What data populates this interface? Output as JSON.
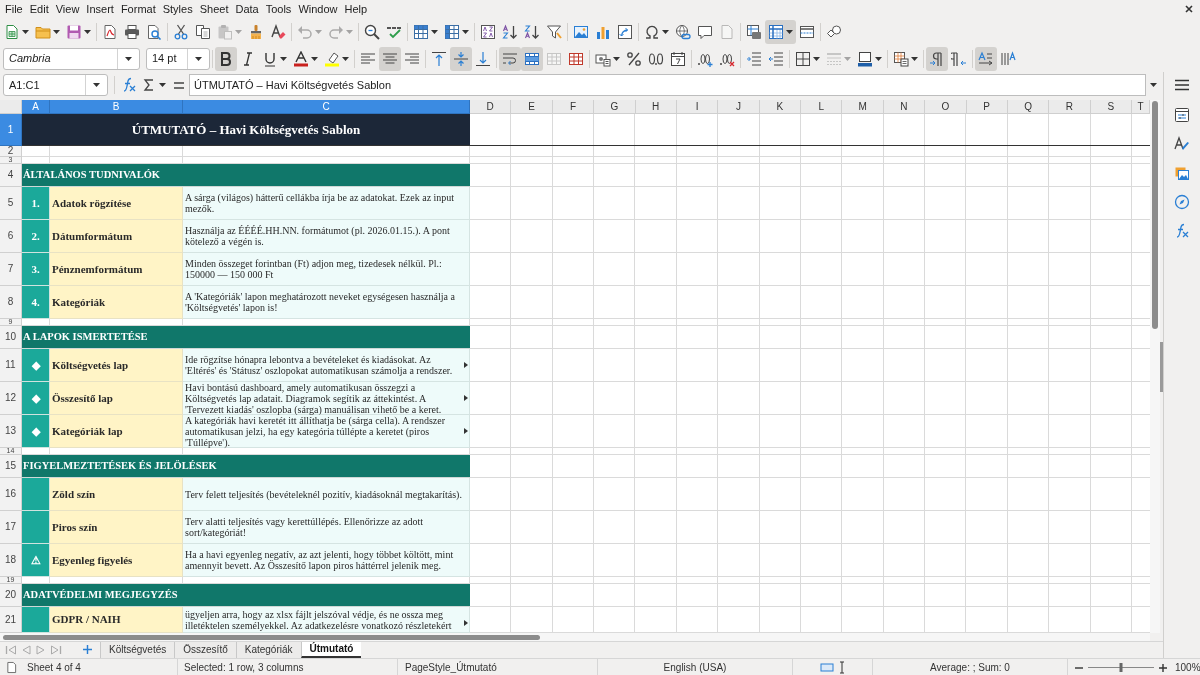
{
  "menu_bar": {
    "items": [
      "File",
      "Edit",
      "View",
      "Insert",
      "Format",
      "Styles",
      "Sheet",
      "Data",
      "Tools",
      "Window",
      "Help"
    ]
  },
  "standard_toolbar": {
    "buttons": [
      {
        "kind": "new",
        "on": false,
        "disabled": false
      },
      {
        "kind": "open",
        "on": false,
        "disabled": false
      },
      {
        "kind": "save",
        "on": false,
        "disabled": false
      },
      {
        "kind": "pdf",
        "on": false,
        "disabled": false
      },
      {
        "kind": "print",
        "on": false,
        "disabled": false
      },
      {
        "kind": "preview",
        "on": false,
        "disabled": false
      },
      {
        "kind": "cut",
        "on": false,
        "disabled": false
      },
      {
        "kind": "copy",
        "on": false,
        "disabled": false
      },
      {
        "kind": "paste",
        "on": false,
        "disabled": true
      },
      {
        "kind": "clone",
        "on": false,
        "disabled": false
      },
      {
        "kind": "clear",
        "on": false,
        "disabled": false
      },
      {
        "kind": "undo",
        "on": false,
        "disabled": true
      },
      {
        "kind": "redo",
        "on": false,
        "disabled": true
      },
      {
        "kind": "find",
        "on": false,
        "disabled": false
      },
      {
        "kind": "spell",
        "on": false,
        "disabled": false
      },
      {
        "kind": "row",
        "on": false,
        "disabled": false
      },
      {
        "kind": "column",
        "on": false,
        "disabled": false
      },
      {
        "kind": "sort",
        "on": false,
        "disabled": false
      },
      {
        "kind": "sortasc",
        "on": false,
        "disabled": false
      },
      {
        "kind": "sortdesc",
        "on": false,
        "disabled": false
      },
      {
        "kind": "filter",
        "on": false,
        "disabled": false
      },
      {
        "kind": "image",
        "on": false,
        "disabled": false
      },
      {
        "kind": "chart",
        "on": false,
        "disabled": false
      },
      {
        "kind": "pivot",
        "on": false,
        "disabled": false
      },
      {
        "kind": "special",
        "on": false,
        "disabled": false
      },
      {
        "kind": "link",
        "on": false,
        "disabled": false
      },
      {
        "kind": "comment",
        "on": false,
        "disabled": false
      },
      {
        "kind": "headerfooter",
        "on": false,
        "disabled": true
      },
      {
        "kind": "printarea",
        "on": false,
        "disabled": false
      },
      {
        "kind": "freeze",
        "on": true,
        "disabled": false
      },
      {
        "kind": "split",
        "on": false,
        "disabled": false
      },
      {
        "kind": "draw",
        "on": false,
        "disabled": false
      }
    ]
  },
  "formatting_toolbar": {
    "font_name": "Cambria",
    "font_size": "14 pt",
    "buttons": [
      {
        "kind": "bold",
        "on": true,
        "disabled": false
      },
      {
        "kind": "italic",
        "on": false,
        "disabled": false
      },
      {
        "kind": "underline",
        "on": false,
        "disabled": false
      },
      {
        "kind": "fontcolor",
        "on": false,
        "disabled": false
      },
      {
        "kind": "highlight",
        "on": false,
        "disabled": false
      },
      {
        "kind": "left",
        "on": false,
        "disabled": false
      },
      {
        "kind": "center",
        "on": true,
        "disabled": false
      },
      {
        "kind": "right",
        "on": false,
        "disabled": false
      },
      {
        "kind": "top",
        "on": false,
        "disabled": false
      },
      {
        "kind": "middle",
        "on": true,
        "disabled": false
      },
      {
        "kind": "bottom",
        "on": false,
        "disabled": false
      },
      {
        "kind": "wrap",
        "on": true,
        "disabled": false
      },
      {
        "kind": "merge",
        "on": true,
        "disabled": false
      },
      {
        "kind": "unmerge",
        "on": false,
        "disabled": true
      },
      {
        "kind": "cellgrid",
        "on": false,
        "disabled": false
      },
      {
        "kind": "currency",
        "on": false,
        "disabled": false
      },
      {
        "kind": "percent",
        "on": false,
        "disabled": false
      },
      {
        "kind": "number",
        "on": false,
        "disabled": false
      },
      {
        "kind": "date",
        "on": false,
        "disabled": false
      },
      {
        "kind": "adddecimal",
        "on": false,
        "disabled": false
      },
      {
        "kind": "deldecimal",
        "on": false,
        "disabled": false
      },
      {
        "kind": "indent",
        "on": false,
        "disabled": false
      },
      {
        "kind": "outdent",
        "on": false,
        "disabled": false
      },
      {
        "kind": "borders",
        "on": false,
        "disabled": false
      },
      {
        "kind": "borderstyle",
        "on": false,
        "disabled": true
      },
      {
        "kind": "bordercolor",
        "on": false,
        "disabled": false
      },
      {
        "kind": "condformat",
        "on": false,
        "disabled": false
      },
      {
        "kind": "ltr",
        "on": true,
        "disabled": false
      },
      {
        "kind": "rtl",
        "on": false,
        "disabled": false
      },
      {
        "kind": "horizontal",
        "on": true,
        "disabled": false
      },
      {
        "kind": "vertical",
        "on": false,
        "disabled": false
      }
    ]
  },
  "formula_bar": {
    "name_box": "A1:C1",
    "formula": "ÚTMUTATÓ – Havi Költségvetés Sablon"
  },
  "sheet": {
    "columns": [
      {
        "label": "A",
        "selected": true
      },
      {
        "label": "B",
        "selected": true
      },
      {
        "label": "C",
        "selected": true
      },
      {
        "label": "D",
        "selected": false
      },
      {
        "label": "E",
        "selected": false
      },
      {
        "label": "F",
        "selected": false
      },
      {
        "label": "G",
        "selected": false
      },
      {
        "label": "H",
        "selected": false
      },
      {
        "label": "I",
        "selected": false
      },
      {
        "label": "J",
        "selected": false
      },
      {
        "label": "K",
        "selected": false
      },
      {
        "label": "L",
        "selected": false
      },
      {
        "label": "M",
        "selected": false
      },
      {
        "label": "N",
        "selected": false
      },
      {
        "label": "O",
        "selected": false
      },
      {
        "label": "P",
        "selected": false
      },
      {
        "label": "Q",
        "selected": false
      },
      {
        "label": "R",
        "selected": false
      },
      {
        "label": "S",
        "selected": false
      },
      {
        "label": "T",
        "selected": false
      }
    ],
    "rows": [
      {
        "number": "1",
        "selected": true,
        "kind": "title",
        "text": "ÚTMUTATÓ – Havi Költségvetés Sablon"
      },
      {
        "number": "2",
        "selected": false,
        "kind": "blank"
      },
      {
        "number": "3",
        "selected": false,
        "kind": "spacer"
      },
      {
        "number": "4",
        "selected": false,
        "kind": "section",
        "text": "ÁLTALÁNOS TUDNIVALÓK"
      },
      {
        "number": "5",
        "selected": false,
        "kind": "item",
        "marker": "1.",
        "label": "Adatok rögzítése",
        "description": "A sárga (világos) hátterű cellákba írja be az adatokat. Ezek az input mezők.",
        "overflow": false
      },
      {
        "number": "6",
        "selected": false,
        "kind": "item",
        "marker": "2.",
        "label": "Dátumformátum",
        "description": "Használja az ÉÉÉÉ.HH.NN. formátumot (pl. 2026.01.15.). A pont kötelező a végén is.",
        "overflow": false
      },
      {
        "number": "7",
        "selected": false,
        "kind": "item",
        "marker": "3.",
        "label": "Pénznemformátum",
        "description": "Minden összeget forintban (Ft) adjon meg, tizedesek nélkül. Pl.: 150000 — 150 000 Ft",
        "overflow": false
      },
      {
        "number": "8",
        "selected": false,
        "kind": "item",
        "marker": "4.",
        "label": "Kategóriák",
        "description": "A 'Kategóriák' lapon meghatározott neveket egységesen használja a 'Költségvetés' lapon is!",
        "overflow": false
      },
      {
        "number": "9",
        "selected": false,
        "kind": "spacer"
      },
      {
        "number": "10",
        "selected": false,
        "kind": "section",
        "text": "A LAPOK ISMERTETÉSE"
      },
      {
        "number": "11",
        "selected": false,
        "kind": "item",
        "marker": "◆",
        "label": "Költségvetés lap",
        "description": "Ide rögzítse hónapra lebontva a bevételeket és kiadásokat. Az 'Eltérés' és 'Státusz' oszlopokat automatikusan számolja a rendszer.",
        "overflow": true
      },
      {
        "number": "12",
        "selected": false,
        "kind": "item",
        "marker": "◆",
        "label": "Összesítő lap",
        "description": "Havi bontású dashboard, amely automatikusan összegzi a Költségvetés lap adatait. Diagramok segítik az áttekintést. A 'Tervezett kiadás' oszlopba (sárga) manuálisan vihető be a keret.",
        "overflow": true
      },
      {
        "number": "13",
        "selected": false,
        "kind": "item",
        "marker": "◆",
        "label": "Kategóriák lap",
        "description": "A kategóriák havi keretét itt állíthatja be (sárga cella). A rendszer automatikusan jelzi, ha egy kategória túllépte a keretet (piros 'Túllépve').",
        "overflow": true
      },
      {
        "number": "14",
        "selected": false,
        "kind": "spacer"
      },
      {
        "number": "15",
        "selected": false,
        "kind": "section",
        "text": "FIGYELMEZTETÉSEK ÉS JELÖLÉSEK"
      },
      {
        "number": "16",
        "selected": false,
        "kind": "item",
        "label": "Zöld szín",
        "description": "Terv felett teljesítés (bevételeknél pozitív, kiadásoknál megtakarítás).",
        "overflow": false
      },
      {
        "number": "17",
        "selected": false,
        "kind": "item",
        "label": "Piros szín",
        "description": "Terv alatti teljesítés vagy kerettúllépés. Ellenőrizze az adott sort/kategóriát!",
        "overflow": false
      },
      {
        "number": "18",
        "selected": false,
        "kind": "item",
        "marker": "⚠",
        "label": "Egyenleg figyelés",
        "description": "Ha a havi egyenleg negatív, az azt jelenti, hogy többet költött, mint amennyit bevett. Az Összesítő lapon piros háttérrel jelenik meg.",
        "overflow": false
      },
      {
        "number": "19",
        "selected": false,
        "kind": "spacer"
      },
      {
        "number": "20",
        "selected": false,
        "kind": "section",
        "text": "ADATVÉDELMI MEGJEGYZÉS"
      },
      {
        "number": "21",
        "selected": false,
        "kind": "item",
        "label": "GDPR / NAIH",
        "description": "ügyeljen arra, hogy az xlsx fájlt jelszóval védje, és ne ossza meg illetéktelen személyekkel. Az adatkezelésre vonatkozó részletekért",
        "overflow": true
      }
    ]
  },
  "sheet_tabs": [
    {
      "label": "Költségvetés",
      "selected": false
    },
    {
      "label": "Összesítő",
      "selected": false
    },
    {
      "label": "Kategóriák",
      "selected": false
    },
    {
      "label": "Útmutató",
      "selected": true
    }
  ],
  "status_bar": {
    "sheet": "Sheet 4 of 4",
    "selection": "Selected: 1 row, 3 columns",
    "page_style": "PageStyle_Útmutató",
    "language": "English (USA)",
    "summary": "Average: ; Sum: 0",
    "zoom": {
      "level": 0.5,
      "reading": "100%"
    }
  }
}
